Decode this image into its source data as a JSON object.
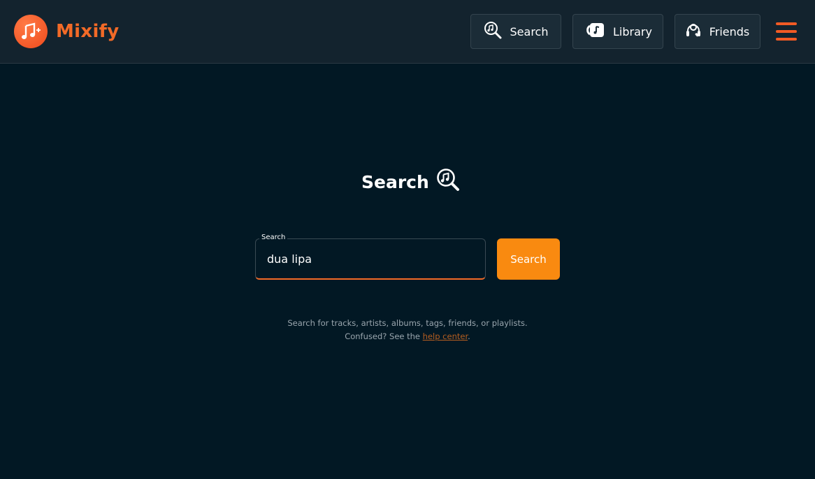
{
  "brand": {
    "name": "Mixify",
    "accent": "#f26a27"
  },
  "nav": {
    "search_label": "Search",
    "library_label": "Library",
    "friends_label": "Friends"
  },
  "main": {
    "title": "Search",
    "field_label": "Search",
    "field_value": "dua lipa",
    "button_label": "Search",
    "hint_line1": "Search for tracks, artists, albums, tags, friends, or playlists.",
    "hint_prefix": "Confused? See the ",
    "hint_link": "help center",
    "hint_suffix": "."
  },
  "colors": {
    "background": "#021824",
    "header": "#13232e",
    "button": "#f98a10"
  }
}
